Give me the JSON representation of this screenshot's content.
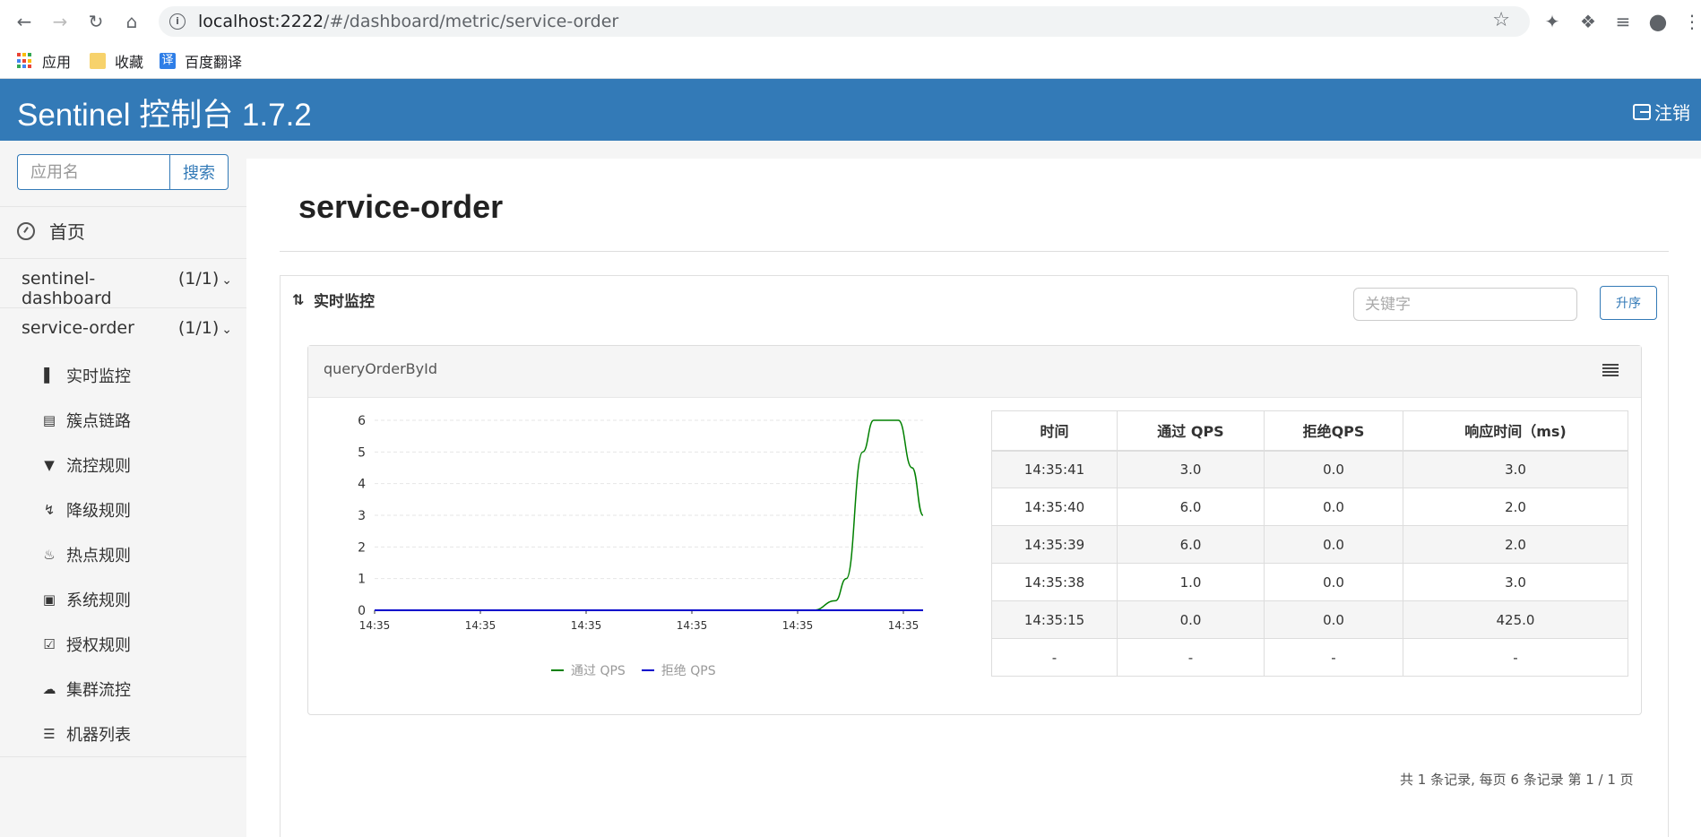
{
  "browser": {
    "url_host": "localhost:2222",
    "url_path": "/#/dashboard/metric/service-order",
    "bookmarks": [
      {
        "label": "应用"
      },
      {
        "label": "收藏"
      },
      {
        "label": "百度翻译"
      }
    ]
  },
  "header": {
    "title": "Sentinel 控制台 1.7.2",
    "logout_label": "注销"
  },
  "sidebar": {
    "search_placeholder": "应用名",
    "search_button": "搜索",
    "home_label": "首页",
    "apps": [
      {
        "name": "sentinel-dashboard",
        "count": "(1/1)"
      },
      {
        "name": "service-order",
        "count": "(1/1)"
      }
    ],
    "menu": [
      {
        "label": "实时监控",
        "icon": "bar-chart-icon"
      },
      {
        "label": "簇点链路",
        "icon": "list-alt-icon"
      },
      {
        "label": "流控规则",
        "icon": "filter-icon"
      },
      {
        "label": "降级规则",
        "icon": "flash-icon"
      },
      {
        "label": "热点规则",
        "icon": "fire-icon"
      },
      {
        "label": "系统规则",
        "icon": "lock-icon"
      },
      {
        "label": "授权规则",
        "icon": "check-icon"
      },
      {
        "label": "集群流控",
        "icon": "cloud-icon"
      },
      {
        "label": "机器列表",
        "icon": "th-list-icon"
      }
    ]
  },
  "main": {
    "page_title": "service-order",
    "panel_title": "实时监控",
    "keyword_placeholder": "关键字",
    "sort_button": "升序",
    "resource_name": "queryOrderById",
    "table": {
      "headers": [
        "时间",
        "通过 QPS",
        "拒绝QPS",
        "响应时间（ms)"
      ],
      "rows": [
        [
          "14:35:41",
          "3.0",
          "0.0",
          "3.0"
        ],
        [
          "14:35:40",
          "6.0",
          "0.0",
          "2.0"
        ],
        [
          "14:35:39",
          "6.0",
          "0.0",
          "2.0"
        ],
        [
          "14:35:38",
          "1.0",
          "0.0",
          "3.0"
        ],
        [
          "14:35:15",
          "0.0",
          "0.0",
          "425.0"
        ],
        [
          "-",
          "-",
          "-",
          "-"
        ]
      ]
    },
    "pager_text": "共 1 条记录, 每页 6 条记录 第 1 / 1 页"
  },
  "chart_data": {
    "type": "line",
    "x_tick_labels": [
      "14:35",
      "14:35",
      "14:35",
      "14:35",
      "14:35",
      "14:35"
    ],
    "y_ticks": [
      0,
      1,
      2,
      3,
      4,
      5,
      6
    ],
    "ylim": [
      0,
      6
    ],
    "series": [
      {
        "name": "通过 QPS",
        "color": "#008000",
        "points": [
          [
            0,
            0
          ],
          [
            0.8,
            0
          ],
          [
            0.84,
            0.3
          ],
          [
            0.86,
            1
          ],
          [
            0.89,
            5
          ],
          [
            0.91,
            6
          ],
          [
            0.955,
            6
          ],
          [
            0.98,
            4.5
          ],
          [
            1.0,
            3
          ]
        ]
      },
      {
        "name": "拒绝 QPS",
        "color": "#0000cc",
        "points": [
          [
            0,
            0
          ],
          [
            1.0,
            0
          ]
        ]
      }
    ]
  }
}
